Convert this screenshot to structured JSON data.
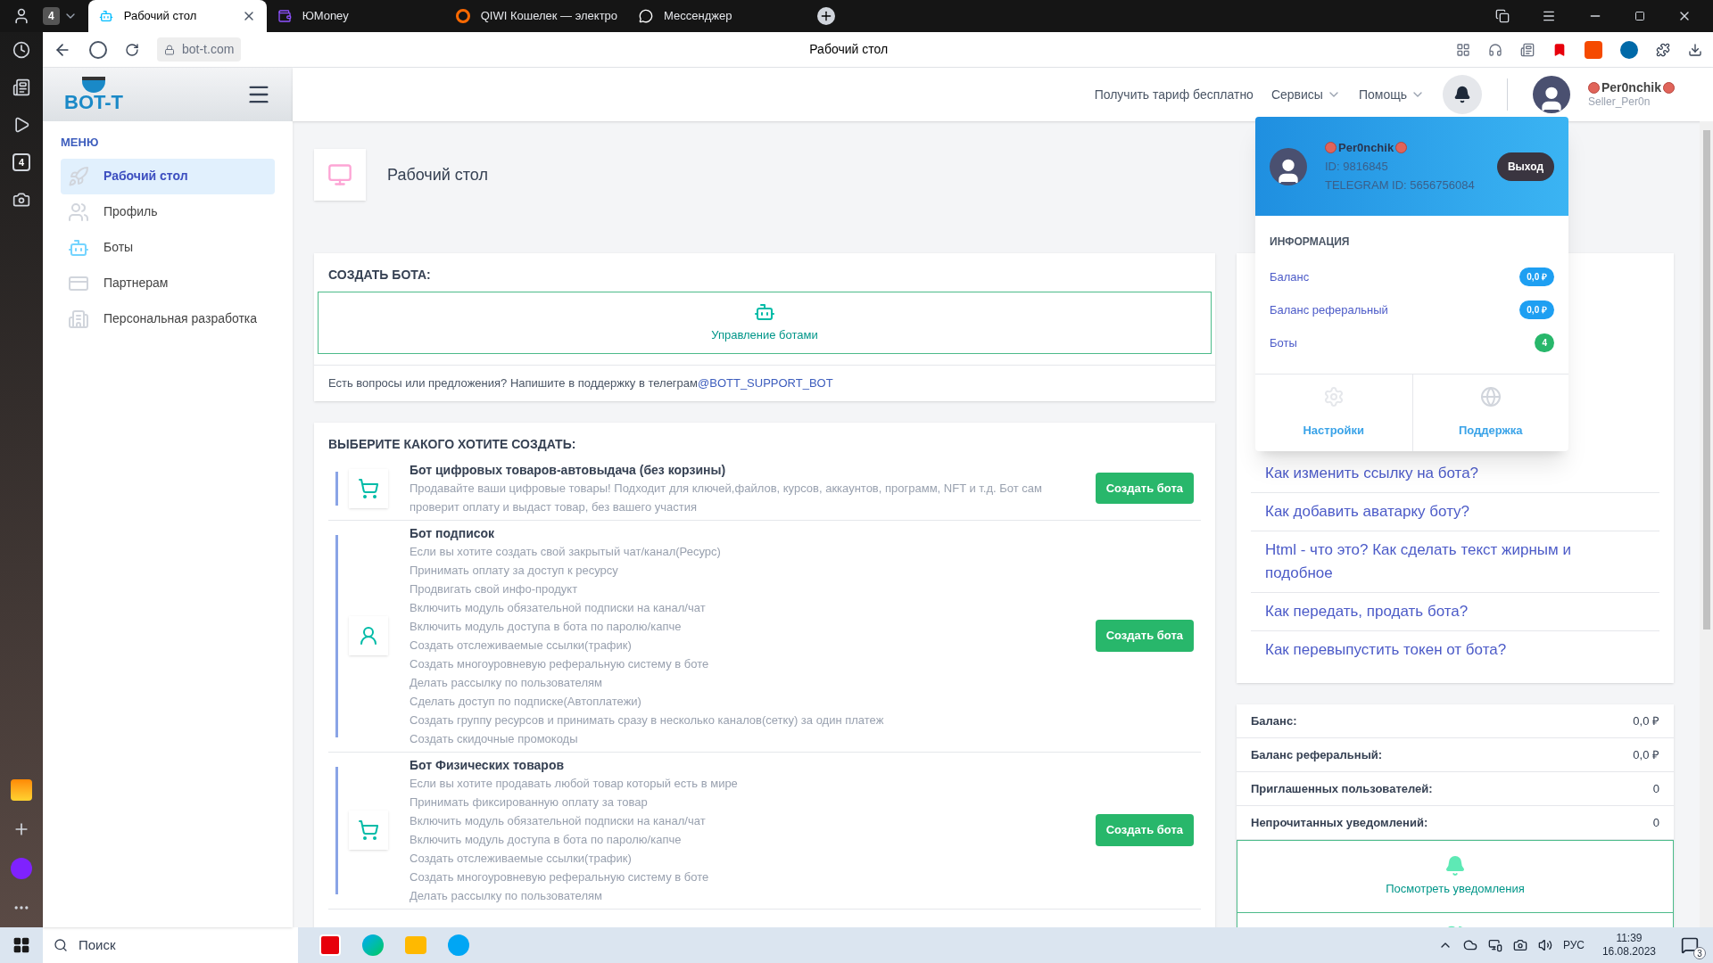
{
  "browser": {
    "tab_count": "4",
    "tabs": [
      {
        "label": "Рабочий стол",
        "selected": true,
        "kind": "bot"
      },
      {
        "label": "ЮMoney",
        "selected": false,
        "kind": "money"
      },
      {
        "label": "QIWI Кошелек — электро",
        "selected": false,
        "kind": "qiwi"
      },
      {
        "label": "Мессенджер",
        "selected": false,
        "kind": "chat"
      }
    ],
    "address": "bot-t.com",
    "page_title": "Рабочий стол",
    "side_badge": "4"
  },
  "sidebar": {
    "logo": "BOT-T",
    "menu_title": "МЕНЮ",
    "items": [
      {
        "label": "Рабочий стол",
        "selected": true,
        "kind": "rocket"
      },
      {
        "label": "Профиль",
        "selected": false,
        "kind": "users"
      },
      {
        "label": "Боты",
        "selected": false,
        "kind": "bot"
      },
      {
        "label": "Партнерам",
        "selected": false,
        "kind": "card"
      },
      {
        "label": "Персональная разработка",
        "selected": false,
        "kind": "building"
      }
    ]
  },
  "header": {
    "promo": "Получить тариф бесплатно",
    "menus": [
      "Сервисы",
      "Помощь"
    ],
    "user": {
      "name": "Per0nchik",
      "login": "Seller_Per0n"
    }
  },
  "dropdown": {
    "name": "Per0nchik",
    "id": "ID: 9816845",
    "telegram": "TELEGRAM ID: 5656756084",
    "logout": "Выход",
    "info_title": "ИНФОРМАЦИЯ",
    "items": [
      {
        "label": "Баланс",
        "value": "0,0 ₽",
        "color": "#1e9ff2"
      },
      {
        "label": "Баланс реферальный",
        "value": "0,0 ₽",
        "color": "#1e9ff2"
      },
      {
        "label": "Боты",
        "value": "4",
        "color": "#28b76b"
      }
    ],
    "actions": [
      {
        "label": "Настройки",
        "kind": "gear"
      },
      {
        "label": "Поддержка",
        "kind": "globe"
      }
    ]
  },
  "page_header": {
    "title": "Рабочий стол"
  },
  "create": {
    "title": "СОЗДАТЬ БОТА:",
    "tile": "Управление ботами",
    "support_text": "Есть вопросы или предложения? Напишите в поддержку в телеграм",
    "support_link": "@BOTT_SUPPORT_BOT"
  },
  "choose": {
    "title": "ВЫБЕРИТЕ КАКОГО ХОТИТЕ СОЗДАТЬ:",
    "bots": [
      {
        "title": "Бот цифровых товаров-автовыдача (без корзины)",
        "kind": "cart",
        "button": "Создать бота",
        "lines": [
          "Продавайте ваши цифровые товары! Подходит для ключей,файлов, курсов, аккаунтов, программ, NFT и т.д. Бот сам проверит оплату и выдаст товар, без вашего участия"
        ]
      },
      {
        "title": "Бот подписок",
        "kind": "person",
        "button": "Создать бота",
        "lines": [
          "Если вы хотите создать свой закрытый чат/канал(Ресурс)",
          "Принимать оплату за доступ к ресурсу",
          "Продвигать свой инфо-продукт",
          "Включить модуль обязательной подписки на канал/чат",
          "Включить модуль доступа в бота по паролю/капче",
          "Создать отслеживаемые ссылки(трафик)",
          "Создать многоуровневую реферальную систему в боте",
          "Делать рассылку по пользователям",
          "Сделать доступ по подписке(Автоплатежи)",
          "Создать группу ресурсов и принимать сразу в несколько каналов(сетку) за один платеж",
          "Создать скидочные промокоды"
        ]
      },
      {
        "title": "Бот Физических товаров",
        "kind": "cart",
        "button": "Создать бота",
        "lines": [
          "Если вы хотите продавать любой товар который есть в мире",
          "Принимать фиксированную оплату за товар",
          "Включить модуль обязательной подписки на канал/чат",
          "Включить модуль доступа в бота по паролю/капче",
          "Создать отслеживаемые ссылки(трафик)",
          "Создать многоуровневую реферальную систему в боте",
          "Делать рассылку по пользователям"
        ]
      }
    ]
  },
  "help_links": [
    "Как изменить ссылку на бота?",
    "Как добавить аватарку боту?",
    "Html - что это? Как сделать текст жирным и подобное",
    "Как передать, продать бота?",
    "Как перевыпустить токен от бота?"
  ],
  "stats": [
    {
      "label": "Баланс:",
      "value": "0,0 ₽"
    },
    {
      "label": "Баланс реферальный:",
      "value": "0,0 ₽"
    },
    {
      "label": "Приглашенных пользователей:",
      "value": "0"
    },
    {
      "label": "Непрочитанных уведомлений:",
      "value": "0"
    }
  ],
  "notifications": {
    "label": "Посмотреть уведомления"
  },
  "taskbar": {
    "search_placeholder": "Поиск",
    "lang": "РУС",
    "time": "11:39",
    "date": "16.08.2023",
    "notification_count": "3"
  }
}
